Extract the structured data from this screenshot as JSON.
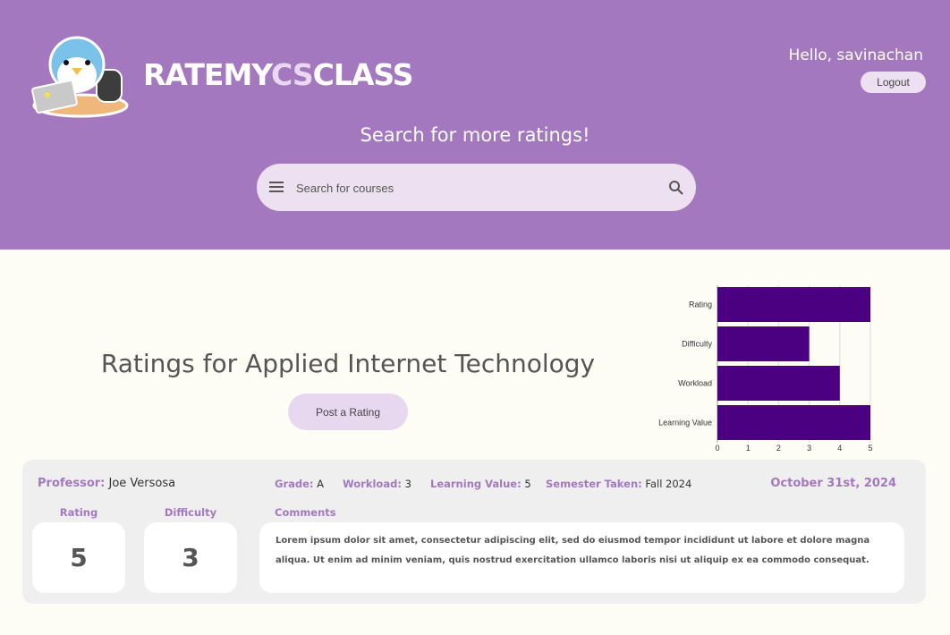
{
  "header": {
    "brand": {
      "part1": "RATEMY",
      "part2": "CS",
      "part3": "CLASS"
    },
    "greeting": "Hello, savinachan",
    "logout_label": "Logout",
    "search_title": "Search for more ratings!",
    "search_placeholder": "Search for courses"
  },
  "course": {
    "title": "Ratings for Applied Internet Technology",
    "post_label": "Post a Rating"
  },
  "chart_data": {
    "type": "bar",
    "orientation": "horizontal",
    "categories": [
      "Rating",
      "Difficulty",
      "Workload",
      "Learning Value"
    ],
    "values": [
      5,
      3,
      4,
      5
    ],
    "xlim": [
      0,
      5
    ],
    "xticks": [
      "0",
      "1",
      "2",
      "3",
      "4",
      "5"
    ],
    "grid": true,
    "color": "#4b0082"
  },
  "review": {
    "professor_label": "Professor:",
    "professor": "Joe Versosa",
    "grade_label": "Grade:",
    "grade": "A",
    "workload_label": "Workload:",
    "workload": "3",
    "learning_label": "Learning Value:",
    "learning": "5",
    "semester_label": "Semester Taken:",
    "semester": "Fall 2024",
    "date": "October 31st, 2024",
    "rating_label": "Rating",
    "rating": "5",
    "difficulty_label": "Difficulty",
    "difficulty": "3",
    "comments_label": "Comments",
    "comments": "Lorem ipsum dolor sit amet, consectetur adipiscing elit, sed do eiusmod tempor incididunt ut labore et dolore magna aliqua. Ut enim ad minim veniam, quis nostrud exercitation ullamco laboris nisi ut aliquip ex ea commodo consequat."
  },
  "colors": {
    "header": "#a478bf",
    "accent": "#a478bf",
    "bar": "#4b0082",
    "background": "#fdfcf5"
  }
}
